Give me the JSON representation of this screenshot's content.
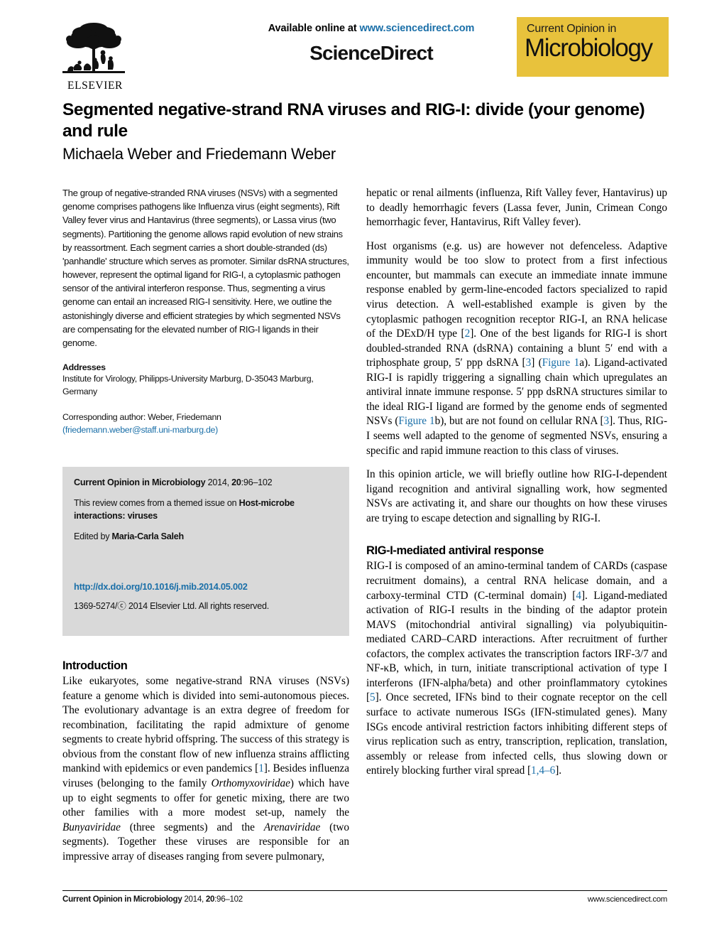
{
  "masthead": {
    "available_online_prefix": "Available online at ",
    "sciencedirect_url": "www.sciencedirect.com",
    "sciencedirect_wordmark": "ScienceDirect",
    "publisher_name": "ELSEVIER",
    "publisher_logo_icon": "elsevier-tree-icon",
    "journal_badge": {
      "line1": "Current Opinion in",
      "line2": "Microbiology",
      "background_color": "#e8c23c"
    }
  },
  "article": {
    "title": "Segmented negative-strand RNA viruses and RIG-I: divide (your genome) and rule",
    "authors": "Michaela Weber and Friedemann Weber"
  },
  "abstract": {
    "text": "The group of negative-stranded RNA viruses (NSVs) with a segmented genome comprises pathogens like Influenza virus (eight segments), Rift Valley fever virus and Hantavirus (three segments), or Lassa virus (two segments). Partitioning the genome allows rapid evolution of new strains by reassortment. Each segment carries a short double-stranded (ds) 'panhandle' structure which serves as promoter. Similar dsRNA structures, however, represent the optimal ligand for RIG-I, a cytoplasmic pathogen sensor of the antiviral interferon response. Thus, segmenting a virus genome can entail an increased RIG-I sensitivity. Here, we outline the astonishingly diverse and efficient strategies by which segmented NSVs are compensating for the elevated number of RIG-I ligands in their genome."
  },
  "addresses": {
    "heading": "Addresses",
    "body": "Institute for Virology, Philipps-University Marburg, D-35043 Marburg, Germany",
    "corresponding_label": "Corresponding author: Weber, Friedemann",
    "corresponding_email": "(friedemann.weber@staff.uni-marburg.de)"
  },
  "infobox": {
    "citation_journal": "Current Opinion in Microbiology",
    "citation_rest_pre": " 2014, ",
    "citation_volume": "20",
    "citation_pages": ":96–102",
    "themed_issue_prefix": "This review comes from a themed issue on ",
    "themed_issue_topic": "Host-microbe interactions: viruses",
    "edited_by_prefix": "Edited by ",
    "edited_by_name": "Maria-Carla Saleh",
    "doi": "http://dx.doi.org/10.1016/j.mib.2014.05.002",
    "copyright": "1369-5274/ⓒ 2014 Elsevier Ltd. All rights reserved.",
    "background_color": "#d9d9d9"
  },
  "introduction": {
    "heading": "Introduction",
    "paragraph_1_part1": "Like eukaryotes, some negative-strand RNA viruses (NSVs) feature a genome which is divided into semi-autonomous pieces. The evolutionary advantage is an extra degree of freedom for recombination, facilitating the rapid admixture of genome segments to create hybrid offspring. The success of this strategy is obvious from the constant flow of new influenza strains afflicting mankind with epidemics or even pandemics [",
    "ref_1": "1",
    "paragraph_1_part2": "]. Besides influenza viruses (belonging to the family ",
    "family_1": "Orthomyxoviridae",
    "paragraph_1_part3": ") which have up to eight segments to offer for genetic mixing, there are two other families with a more modest set-up, namely the ",
    "family_2": "Bunyaviridae",
    "paragraph_1_part4": " (three segments) and the ",
    "family_3": "Arenaviridae",
    "paragraph_1_part5": " (two segments). Together these viruses are responsible for an impressive array of diseases ranging from severe pulmonary,"
  },
  "right_column": {
    "para_continuation": "hepatic or renal ailments (influenza, Rift Valley fever, Hantavirus) up to deadly hemorrhagic fevers (Lassa fever, Junin, Crimean Congo hemorrhagic fever, Hantavirus, Rift Valley fever).",
    "para_host_p1": "Host organisms (e.g. us) are however not defenceless. Adaptive immunity would be too slow to protect from a first infectious encounter, but mammals can execute an immediate innate immune response enabled by germ-line-encoded factors specialized to rapid virus detection. A well-established example is given by the cytoplasmic pathogen recognition receptor RIG-I, an RNA helicase of the DExD/H type [",
    "ref_2": "2",
    "para_host_p2": "]. One of the best ligands for RIG-I is short doubled-stranded RNA (dsRNA) containing a blunt 5′ end with a triphosphate group, 5′ ppp dsRNA [",
    "ref_3": "3",
    "para_host_p3": "] (",
    "figure_link_1a": "Figure 1",
    "para_host_p4": "a). Ligand-activated RIG-I is rapidly triggering a signalling chain which upregulates an antiviral innate immune response. 5′ ppp dsRNA structures similar to the ideal RIG-I ligand are formed by the genome ends of segmented NSVs (",
    "figure_link_1b": "Figure 1",
    "para_host_p5": "b), but are not found on cellular RNA [",
    "ref_3b": "3",
    "para_host_p6": "]. Thus, RIG-I seems well adapted to the genome of segmented NSVs, ensuring a specific and rapid immune reaction to this class of viruses.",
    "para_opinion": "In this opinion article, we will briefly outline how RIG-I-dependent ligand recognition and antiviral signalling work, how segmented NSVs are activating it, and share our thoughts on how these viruses are trying to escape detection and signalling by RIG-I.",
    "section_heading": "RIG-I-mediated antiviral response",
    "para_rig_p1": "RIG-I is composed of an amino-terminal tandem of CARDs (caspase recruitment domains), a central RNA helicase domain, and a carboxy-terminal CTD (C-terminal domain) [",
    "ref_4": "4",
    "para_rig_p2": "]. Ligand-mediated activation of RIG-I results in the binding of the adaptor protein MAVS (mitochondrial antiviral signalling) via polyubiquitin-mediated CARD–CARD interactions. After recruitment of further cofactors, the complex activates the transcription factors IRF-3/7 and NF-κB, which, in turn, initiate transcriptional activation of type I interferons (IFN-alpha/beta) and other proinflammatory cytokines [",
    "ref_5": "5",
    "para_rig_p3": "]. Once secreted, IFNs bind to their cognate receptor on the cell surface to activate numerous ISGs (IFN-stimulated genes). Many ISGs encode antiviral restriction factors inhibiting different steps of virus replication such as entry, transcription, replication, translation, assembly or release from infected cells, thus slowing down or entirely blocking further viral spread [",
    "ref_146": "1,4–6",
    "para_rig_p4": "]."
  },
  "footer": {
    "journal_ref_bold": "Current Opinion in Microbiology",
    "journal_ref_plain": " 2014, ",
    "journal_ref_volume": "20",
    "journal_ref_pages": ":96–102",
    "site": "www.sciencedirect.com"
  },
  "colors": {
    "link_blue": "#1a6fa8",
    "badge_yellow": "#e8c23c",
    "infobox_gray": "#d9d9d9"
  }
}
